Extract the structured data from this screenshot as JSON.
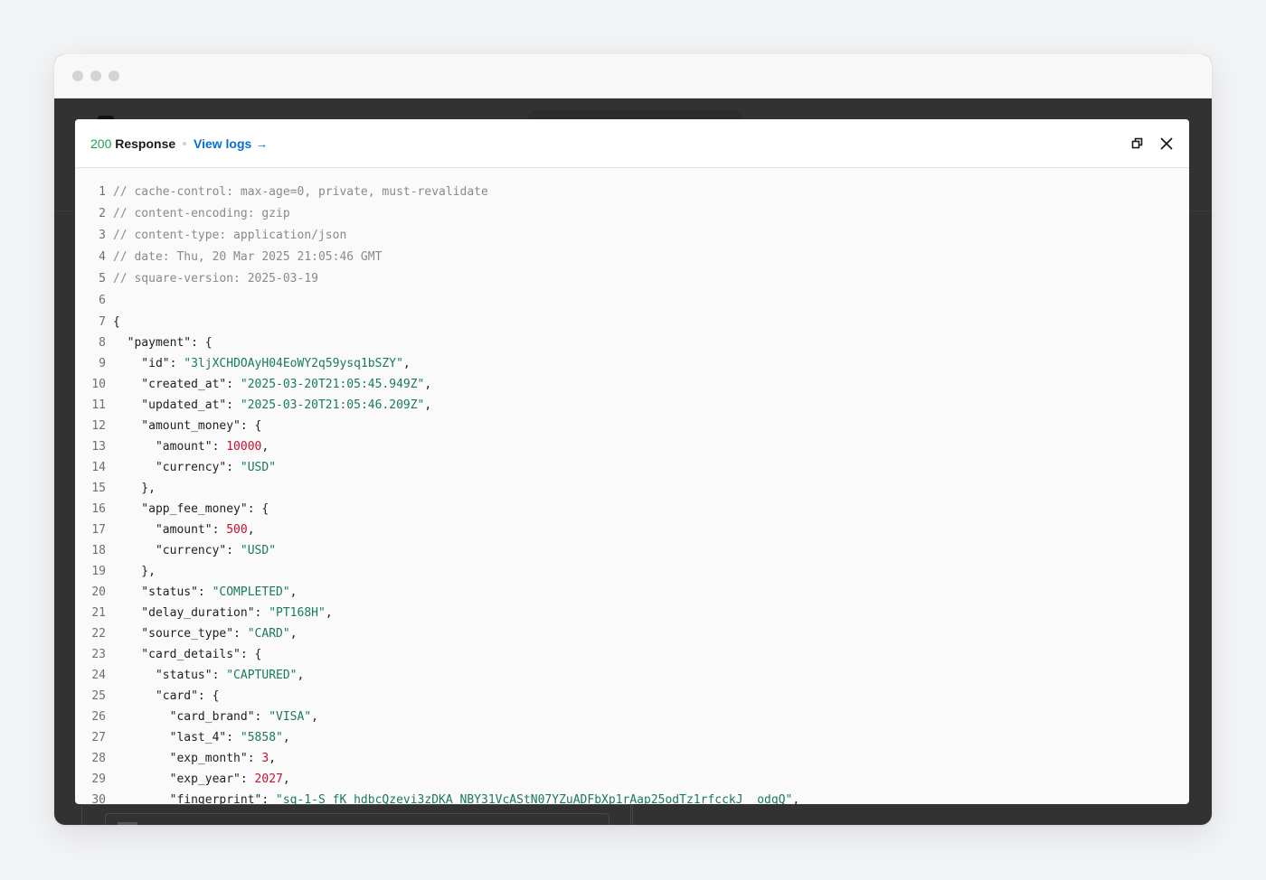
{
  "response": {
    "status_code": "200",
    "status_text": "Response",
    "view_logs_label": "View logs →"
  },
  "icons": {
    "copy": "copy-icon",
    "close": "close-icon"
  },
  "code_lines": [
    [
      {
        "t": "c",
        "v": "// cache-control: max-age=0, private, must-revalidate"
      }
    ],
    [
      {
        "t": "c",
        "v": "// content-encoding: gzip"
      }
    ],
    [
      {
        "t": "c",
        "v": "// content-type: application/json"
      }
    ],
    [
      {
        "t": "c",
        "v": "// date: Thu, 20 Mar 2025 21:05:46 GMT"
      }
    ],
    [
      {
        "t": "c",
        "v": "// square-version: 2025-03-19"
      }
    ],
    [],
    [
      {
        "t": "p",
        "v": "{"
      }
    ],
    [
      {
        "t": "p",
        "v": "  \"payment\": {"
      }
    ],
    [
      {
        "t": "p",
        "v": "    \"id\": "
      },
      {
        "t": "s",
        "v": "\"3ljXCHDOAyH04EoWY2q59ysq1bSZY\""
      },
      {
        "t": "p",
        "v": ","
      }
    ],
    [
      {
        "t": "p",
        "v": "    \"created_at\": "
      },
      {
        "t": "s",
        "v": "\"2025-03-20T21:05:45.949Z\""
      },
      {
        "t": "p",
        "v": ","
      }
    ],
    [
      {
        "t": "p",
        "v": "    \"updated_at\": "
      },
      {
        "t": "s",
        "v": "\"2025-03-20T21:05:46.209Z\""
      },
      {
        "t": "p",
        "v": ","
      }
    ],
    [
      {
        "t": "p",
        "v": "    \"amount_money\": {"
      }
    ],
    [
      {
        "t": "p",
        "v": "      \"amount\": "
      },
      {
        "t": "n",
        "v": "10000"
      },
      {
        "t": "p",
        "v": ","
      }
    ],
    [
      {
        "t": "p",
        "v": "      \"currency\": "
      },
      {
        "t": "s",
        "v": "\"USD\""
      }
    ],
    [
      {
        "t": "p",
        "v": "    },"
      }
    ],
    [
      {
        "t": "p",
        "v": "    \"app_fee_money\": {"
      }
    ],
    [
      {
        "t": "p",
        "v": "      \"amount\": "
      },
      {
        "t": "n",
        "v": "500"
      },
      {
        "t": "p",
        "v": ","
      }
    ],
    [
      {
        "t": "p",
        "v": "      \"currency\": "
      },
      {
        "t": "s",
        "v": "\"USD\""
      }
    ],
    [
      {
        "t": "p",
        "v": "    },"
      }
    ],
    [
      {
        "t": "p",
        "v": "    \"status\": "
      },
      {
        "t": "s",
        "v": "\"COMPLETED\""
      },
      {
        "t": "p",
        "v": ","
      }
    ],
    [
      {
        "t": "p",
        "v": "    \"delay_duration\": "
      },
      {
        "t": "s",
        "v": "\"PT168H\""
      },
      {
        "t": "p",
        "v": ","
      }
    ],
    [
      {
        "t": "p",
        "v": "    \"source_type\": "
      },
      {
        "t": "s",
        "v": "\"CARD\""
      },
      {
        "t": "p",
        "v": ","
      }
    ],
    [
      {
        "t": "p",
        "v": "    \"card_details\": {"
      }
    ],
    [
      {
        "t": "p",
        "v": "      \"status\": "
      },
      {
        "t": "s",
        "v": "\"CAPTURED\""
      },
      {
        "t": "p",
        "v": ","
      }
    ],
    [
      {
        "t": "p",
        "v": "      \"card\": {"
      }
    ],
    [
      {
        "t": "p",
        "v": "        \"card_brand\": "
      },
      {
        "t": "s",
        "v": "\"VISA\""
      },
      {
        "t": "p",
        "v": ","
      }
    ],
    [
      {
        "t": "p",
        "v": "        \"last_4\": "
      },
      {
        "t": "s",
        "v": "\"5858\""
      },
      {
        "t": "p",
        "v": ","
      }
    ],
    [
      {
        "t": "p",
        "v": "        \"exp_month\": "
      },
      {
        "t": "n",
        "v": "3"
      },
      {
        "t": "p",
        "v": ","
      }
    ],
    [
      {
        "t": "p",
        "v": "        \"exp_year\": "
      },
      {
        "t": "n",
        "v": "2027"
      },
      {
        "t": "p",
        "v": ","
      }
    ],
    [
      {
        "t": "p",
        "v": "        \"fingerprint\": "
      },
      {
        "t": "s",
        "v": "\"sq-1-S_fK_hdbcQzevi3zDKA_NBY31VcAStN07YZuADFbXp1rAap25odTz1rfcckJ__odqQ\""
      },
      {
        "t": "p",
        "v": ","
      }
    ]
  ],
  "colors": {
    "status_ok": "#1ca34a",
    "link": "#0b6ed0",
    "string": "#1a7a5a",
    "number": "#c8102e",
    "comment": "#8a8a8a"
  }
}
